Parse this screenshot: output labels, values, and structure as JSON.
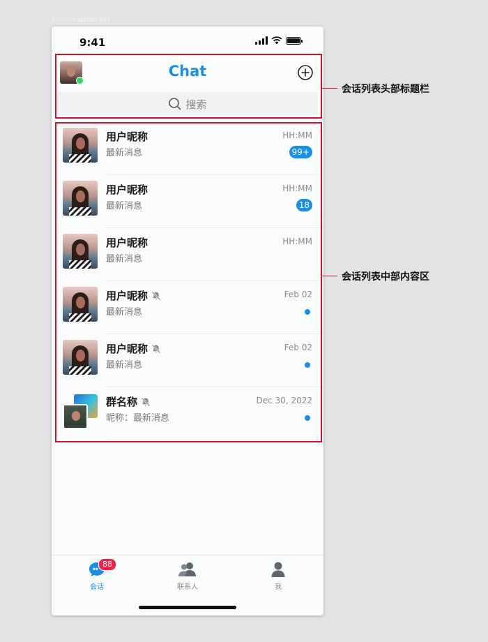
{
  "frame_label": "conversation list",
  "status": {
    "time": "9:41"
  },
  "header": {
    "title": "Chat",
    "search_placeholder": "搜索"
  },
  "conversations": [
    {
      "name": "用户昵称",
      "message": "最新消息",
      "time": "HH:MM",
      "badge": "99+",
      "muted": false
    },
    {
      "name": "用户昵称",
      "message": "最新消息",
      "time": "HH:MM",
      "badge": "18",
      "muted": false
    },
    {
      "name": "用户昵称",
      "message": "最新消息",
      "time": "HH:MM",
      "badge": "",
      "muted": false
    },
    {
      "name": "用户昵称",
      "message": "最新消息",
      "time": "Feb 02",
      "badge": "",
      "muted": true
    },
    {
      "name": "用户昵称",
      "message": "最新消息",
      "time": "Feb 02",
      "badge": "",
      "muted": true
    },
    {
      "name": "群名称",
      "message": "昵称：最新消息",
      "time": "Dec 30, 2022",
      "badge": "",
      "muted": true
    }
  ],
  "tabbar": {
    "tabs": [
      {
        "label": "会话",
        "badge": "88",
        "icon": "chat-bubble-icon"
      },
      {
        "label": "联系人",
        "icon": "contacts-icon"
      },
      {
        "label": "我",
        "icon": "person-icon"
      }
    ]
  },
  "annotations": {
    "header": "会话列表头部标题栏",
    "content": "会话列表中部内容区"
  },
  "colors": {
    "accent": "#1a8fe8",
    "annotation": "#d0112b",
    "badge_red": "#f0244a",
    "online": "#2fd169"
  }
}
